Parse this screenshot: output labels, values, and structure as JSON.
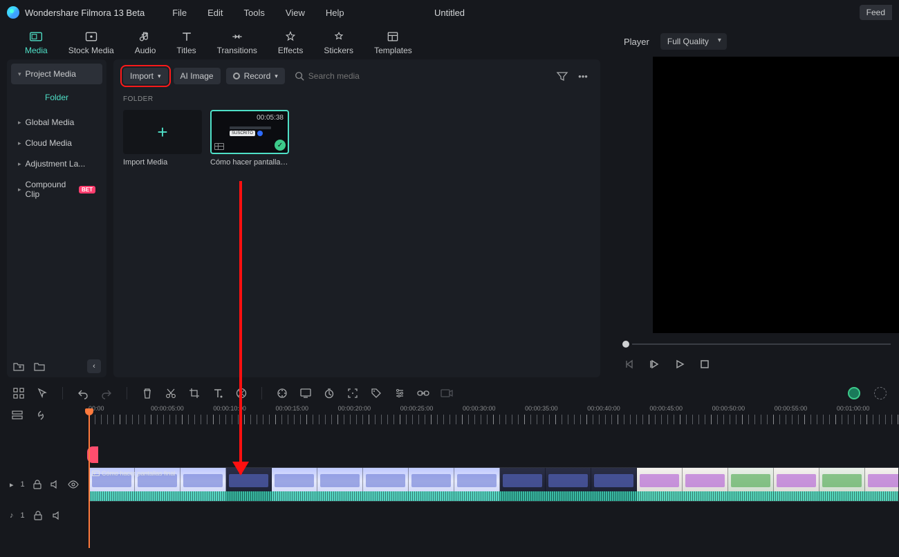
{
  "app": {
    "title": "Wondershare Filmora 13 Beta",
    "doc": "Untitled",
    "feedback": "Feed"
  },
  "menu": {
    "file": "File",
    "edit": "Edit",
    "tools": "Tools",
    "view": "View",
    "help": "Help"
  },
  "tabs": {
    "media": "Media",
    "stock": "Stock Media",
    "audio": "Audio",
    "titles": "Titles",
    "transitions": "Transitions",
    "effects": "Effects",
    "stickers": "Stickers",
    "templates": "Templates"
  },
  "sidebar": {
    "project": "Project Media",
    "folder": "Folder",
    "global": "Global Media",
    "cloud": "Cloud Media",
    "adjust": "Adjustment La...",
    "compound": "Compound Clip",
    "badge": "BET"
  },
  "toolbar": {
    "import": "Import",
    "aiimage": "AI Image",
    "record": "Record",
    "search_ph": "Search media"
  },
  "content": {
    "folder_label": "FOLDER",
    "import_label": "Import Media",
    "clip_label": "Cómo hacer pantallas ...",
    "clip_duration": "00:05:38",
    "mini_pill": "SUSCRITO"
  },
  "player": {
    "label": "Player",
    "quality": "Full Quality"
  },
  "timeline": {
    "stamps": [
      "00:00",
      "00:00:05:00",
      "00:00:10:00",
      "00:00:15:00",
      "00:00:20:00",
      "00:00:25:00",
      "00:00:30:00",
      "00:00:35:00",
      "00:00:40:00",
      "00:00:45:00",
      "00:00:50:00",
      "00:00:55:00",
      "00:01:00:00"
    ],
    "clip_label": "Cómo hacer pantallas final",
    "vtrack_idx": "1",
    "atrack_idx": "1",
    "vtrack_icon": "▸",
    "atrack_icon": "♪"
  }
}
